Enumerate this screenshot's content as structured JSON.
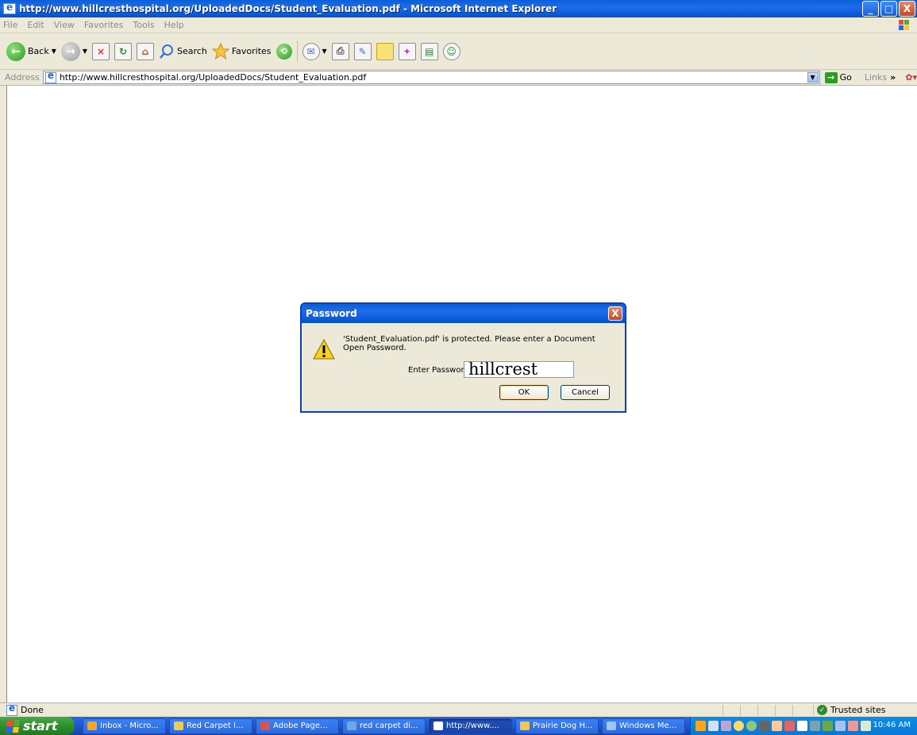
{
  "window": {
    "title": "http://www.hillcresthospital.org/UploadedDocs/Student_Evaluation.pdf - Microsoft Internet Explorer",
    "minimize": "_",
    "maximize": "□",
    "close": "X"
  },
  "menu": [
    "File",
    "Edit",
    "View",
    "Favorites",
    "Tools",
    "Help"
  ],
  "toolbar": {
    "back_label": "Back",
    "search_label": "Search",
    "favorites_label": "Favorites"
  },
  "address": {
    "label": "Address",
    "url": "http://www.hillcresthospital.org/UploadedDocs/Student_Evaluation.pdf",
    "go_label": "Go",
    "links_label": "Links",
    "links_chevron": "»"
  },
  "dialog": {
    "title": "Password",
    "close": "X",
    "message": "'Student_Evaluation.pdf' is protected.  Please enter a Document Open Password.",
    "field_label": "Enter Password:",
    "field_value": "hillcrest",
    "ok_label": "OK",
    "cancel_label": "Cancel"
  },
  "status": {
    "left": "Done",
    "zone": "Trusted sites"
  },
  "taskbar": {
    "start_label": "start",
    "tasks": [
      {
        "label": "Inbox - Micro...",
        "icon_color": "#f6a623",
        "active": false
      },
      {
        "label": "Red Carpet I...",
        "icon_color": "#f2c94c",
        "active": false
      },
      {
        "label": "Adobe Page...",
        "icon_color": "#d9534f",
        "active": false
      },
      {
        "label": "red carpet di...",
        "icon_color": "#6fa8dc",
        "active": false
      },
      {
        "label": "http://www....",
        "icon_color": "#ffffff",
        "active": true
      },
      {
        "label": "Prairie Dog H...",
        "icon_color": "#f2c94c",
        "active": false
      },
      {
        "label": "Windows Me...",
        "icon_color": "#9fc5e8",
        "active": false
      }
    ],
    "clock": "10:46 AM"
  },
  "colors": {
    "title_blue": "#0A5FD8",
    "taskbar_blue": "#245edb",
    "start_green": "#2d8f2d",
    "tray_blue": "#0f8be8"
  }
}
